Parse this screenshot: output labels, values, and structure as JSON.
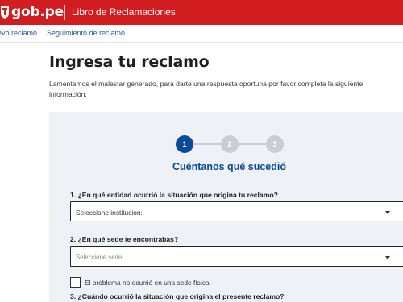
{
  "header": {
    "logo_text": "gob.pe",
    "title": "Libro de Reclamaciones",
    "brand_color": "#d11d20"
  },
  "subnav": {
    "new_claim": "evo reclamo",
    "follow_up": "Seguimiento de reclamo"
  },
  "page": {
    "title": "Ingresa tu reclamo",
    "intro": "Lamentamos el malestar generado, para darte una respuesta oportuna por favor completa la siguiente información:"
  },
  "stepper": {
    "steps": [
      "1",
      "2",
      "3"
    ],
    "active_step": 1,
    "active_color": "#0b4a9a",
    "heading": "Cuéntanos qué sucedió"
  },
  "form": {
    "q1_label": "1. ¿En qué entidad ocurrió la situación que origina tu reclamo?",
    "q1_value": "Seleccione institucion:",
    "q2_label": "2. ¿En qué sede te encontrabas?",
    "q2_placeholder": "Seleccione sede",
    "checkbox_label": "El problema no ocurrió en una sede física.",
    "checkbox_checked": false,
    "q3_label": "3. ¿Cuándo ocurrió la situación que origina el presente reclamo?"
  },
  "icons": {
    "logo": "peru-shield-icon",
    "dropdown": "chevron-down-icon"
  }
}
